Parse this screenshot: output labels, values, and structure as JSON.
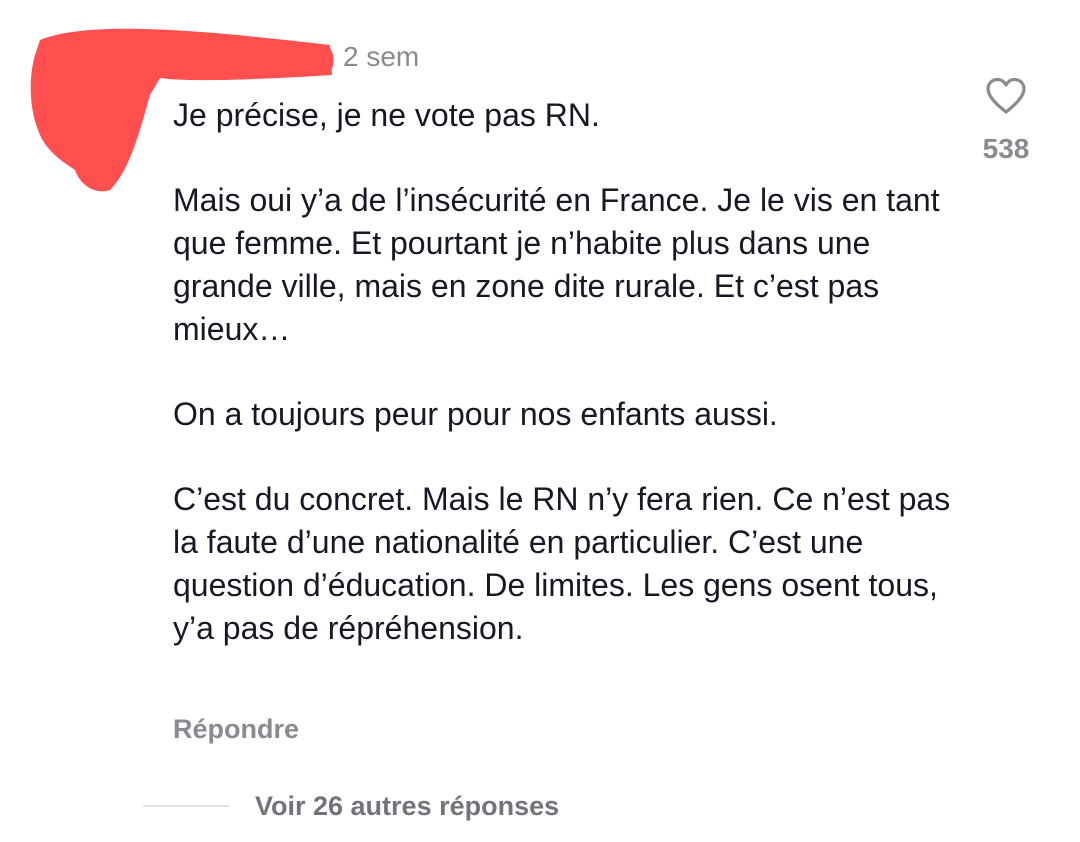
{
  "comment": {
    "timestamp": "2 sem",
    "paragraphs": [
      "Je précise, je ne vote pas RN.",
      "Mais oui y’a de l’insécurité en France. Je le vis en tant que femme. Et pourtant je n’habite plus dans une grande ville, mais en zone dite rurale. Et c’est pas mieux…",
      "On a toujours peur pour nos enfants aussi.",
      "C’est du concret. Mais le RN n’y fera rien. Ce n’est pas la faute d’une nationalité en particulier. C’est une question d’éducation. De limites. Les gens osent tous, y’a pas de répréhension."
    ],
    "reply_label": "Répondre",
    "like_count": "538",
    "like_icon": "heart-outline-icon"
  },
  "replies": {
    "more_label": "Voir 26 autres réponses"
  },
  "colors": {
    "redaction": "#ff4f4f",
    "text": "#161823",
    "muted": "#8a8b91"
  }
}
